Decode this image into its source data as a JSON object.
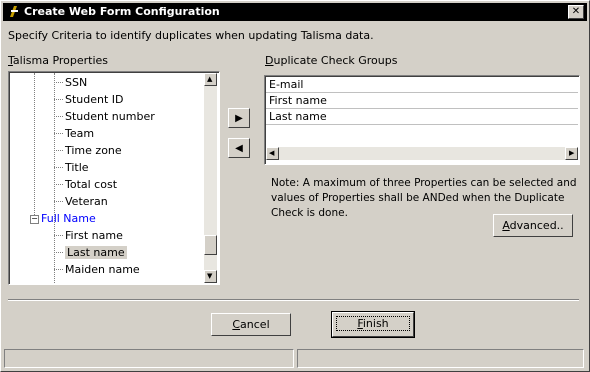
{
  "window": {
    "title": "Create Web Form Configuration",
    "close_glyph": "✕"
  },
  "instruction": "Specify Criteria to identify duplicates when updating Talisma data.",
  "left_panel": {
    "label_prefix": "T",
    "label_rest": "alisma Properties",
    "items": [
      "SSN",
      "Student ID",
      "Student number",
      "Team",
      "Time zone",
      "Title",
      "Total cost",
      "Veteran"
    ],
    "group": {
      "toggle": "−",
      "label": "Full Name"
    },
    "group_items": [
      "First name",
      "Last name",
      "Maiden name"
    ],
    "selected": "Last name"
  },
  "right_panel": {
    "label_prefix": "D",
    "label_rest": "uplicate Check Groups",
    "rows": [
      "E-mail",
      "First name",
      "Last name"
    ]
  },
  "move": {
    "add": "▶",
    "remove": "◀"
  },
  "note": "Note: A maximum of three Properties can be selected and values of Properties shall be ANDed when the Duplicate Check is done.",
  "buttons": {
    "advanced_prefix": "A",
    "advanced_rest": "dvanced..",
    "cancel_prefix": "C",
    "cancel_rest": "ancel",
    "finish_prefix": "F",
    "finish_rest": "inish"
  },
  "scroll_glyphs": {
    "up": "▲",
    "down": "▼",
    "left": "◀",
    "right": "▶"
  }
}
